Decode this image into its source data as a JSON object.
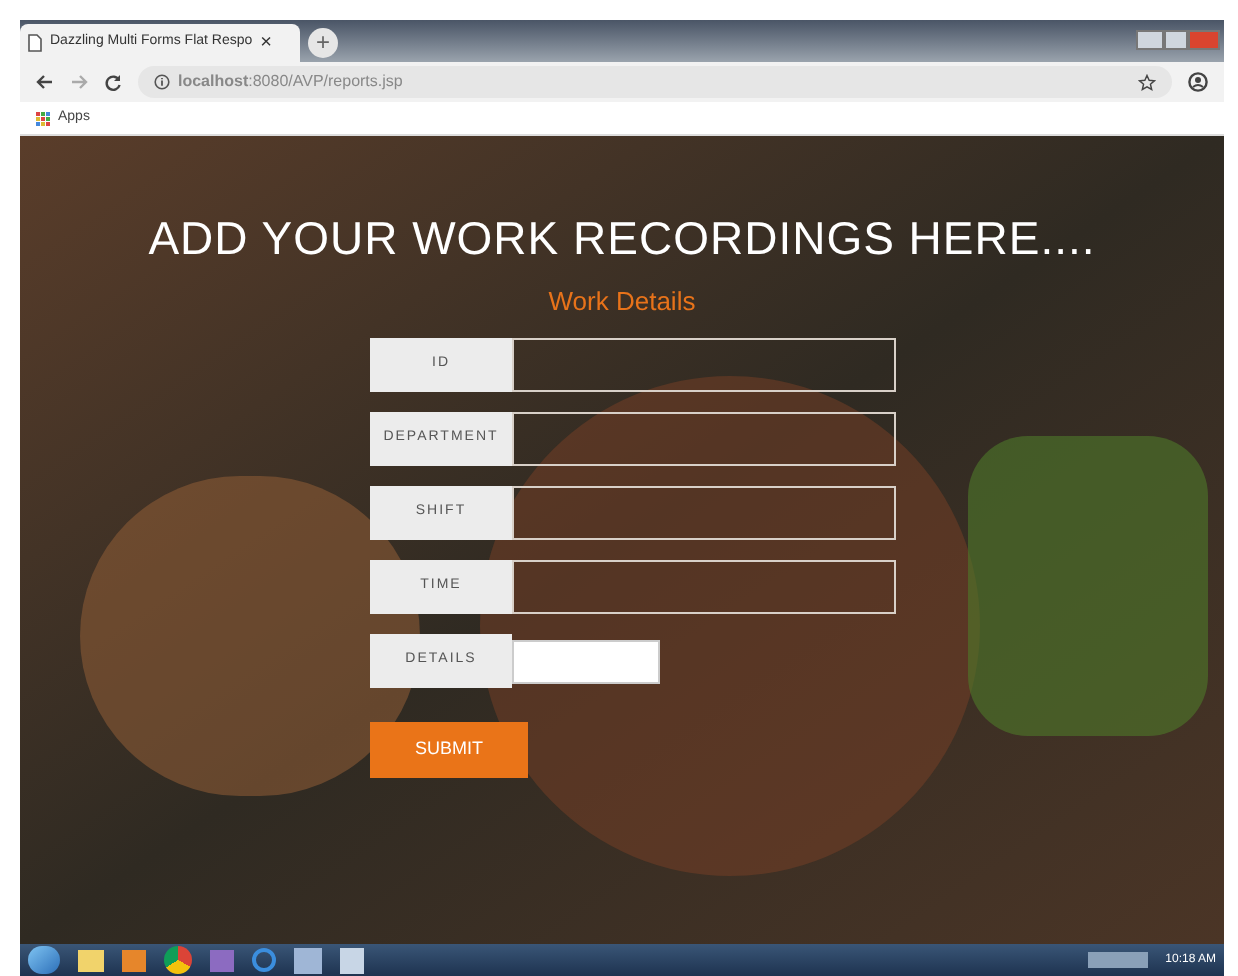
{
  "browser": {
    "tab_title": "Dazzling Multi Forms Flat Respo",
    "tab_close": "×",
    "new_tab": "+",
    "address": "**localhost**:8080/AVP/reports.jsp",
    "bookmarks": [
      "Apps"
    ]
  },
  "page": {
    "heading": "ADD YOUR WORK RECORDINGS HERE....",
    "form_title": "Work Details",
    "fields": [
      {
        "label": "ID",
        "kind": "text"
      },
      {
        "label": "DEPARTMENT",
        "kind": "text"
      },
      {
        "label": "SHIFT",
        "kind": "text"
      },
      {
        "label": "TIME",
        "kind": "text"
      },
      {
        "label": "DETAILS",
        "kind": "textarea"
      }
    ],
    "submit": "SUBMIT"
  },
  "taskbar": {
    "clock": "10:18 AM"
  }
}
